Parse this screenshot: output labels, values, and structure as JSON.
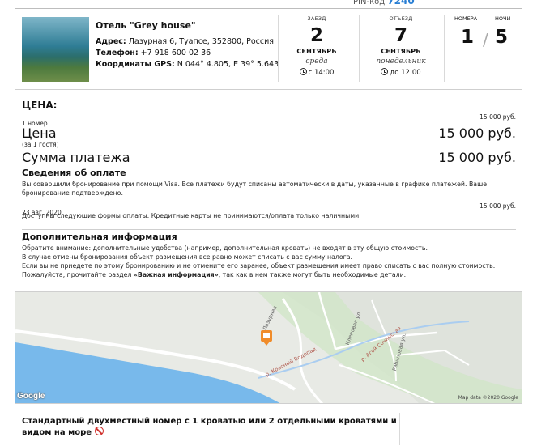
{
  "pin": {
    "label": "PIN-код",
    "value": "7240"
  },
  "hotel": {
    "name": "Отель \"Grey house\"",
    "address_label": "Адрес:",
    "address": "Лазурная 6, Туапсе, 352800, Россия",
    "phone_label": "Телефон:",
    "phone": "+7 918 600 02 36",
    "gps_label": "Координаты GPS:",
    "gps": "N 044° 4.805, E 39° 5.643"
  },
  "checkin": {
    "caption": "ЗАЕЗД",
    "day": "2",
    "month": "СЕНТЯБРЬ",
    "weekday": "среда",
    "time": "с 14:00"
  },
  "checkout": {
    "caption": "ОТЪЕЗД",
    "day": "7",
    "month": "СЕНТЯБРЬ",
    "weekday": "понедельник",
    "time": "до 12:00"
  },
  "counts": {
    "rooms_caption": "НОМЕРА",
    "rooms": "1",
    "nights_caption": "НОЧИ",
    "nights": "5",
    "separator": "/"
  },
  "price": {
    "heading": "ЦЕНА:",
    "rooms_line": "1 номер",
    "rooms_line_amount": "15 000 руб.",
    "price_label": "Цена",
    "price_sub": "(за 1 гостя)",
    "price_amount": "15 000 руб.",
    "total_label": "Сумма платежа",
    "total_amount": "15 000 руб."
  },
  "payment": {
    "heading": "Сведения об оплате",
    "text_line1": "Вы совершили бронирование при помощи Visa. Все платежи будут списаны автоматически в даты, указанные в графике платежей. Ваше",
    "text_line2": "бронирование подтверждено.",
    "date": "23 авг. 2020",
    "date_amount": "15 000 руб.",
    "forms": "Доступны следующие формы оплаты: Кредитные карты не принимаются/оплата только наличными"
  },
  "additional": {
    "heading": "Дополнительная информация",
    "line1": "Обратите внимание: дополнительные удобства (например, дополнительная кровать) не входят в эту общую стоимость.",
    "line2": "В случае отмены бронирования объект размещения все равно может списать с вас сумму налога.",
    "line3": "Если вы не приедете по этому бронированию и не отмените его заранее, объект размещения имеет право списать с вас полную стоимость.",
    "line4_pre": "Пожалуйста, прочитайте раздел ",
    "line4_bold": "«Важная информация»",
    "line4_post": ", так как в нем также могут быть необходимые детали."
  },
  "map": {
    "logo": "Google",
    "attribution": "Map data ©2020 Google",
    "street_1": "Лазурная",
    "street_2": "р. Красный Водопад",
    "street_3": "Кленовая ул.",
    "street_4": "р. Агой Сочинская",
    "street_5": "Рябиновая ул.",
    "colors": {
      "sea": "#78b9eb",
      "land": "#e8eae5",
      "green": "#cfe5c4",
      "road": "#ffffff",
      "river": "#aacdf0",
      "marker": "#f08c2a"
    }
  },
  "room": {
    "title": "Стандартный двухместный номер с 1 кроватью или 2 отдельными кроватями и видом на море",
    "icon": "no-smoking-icon"
  }
}
